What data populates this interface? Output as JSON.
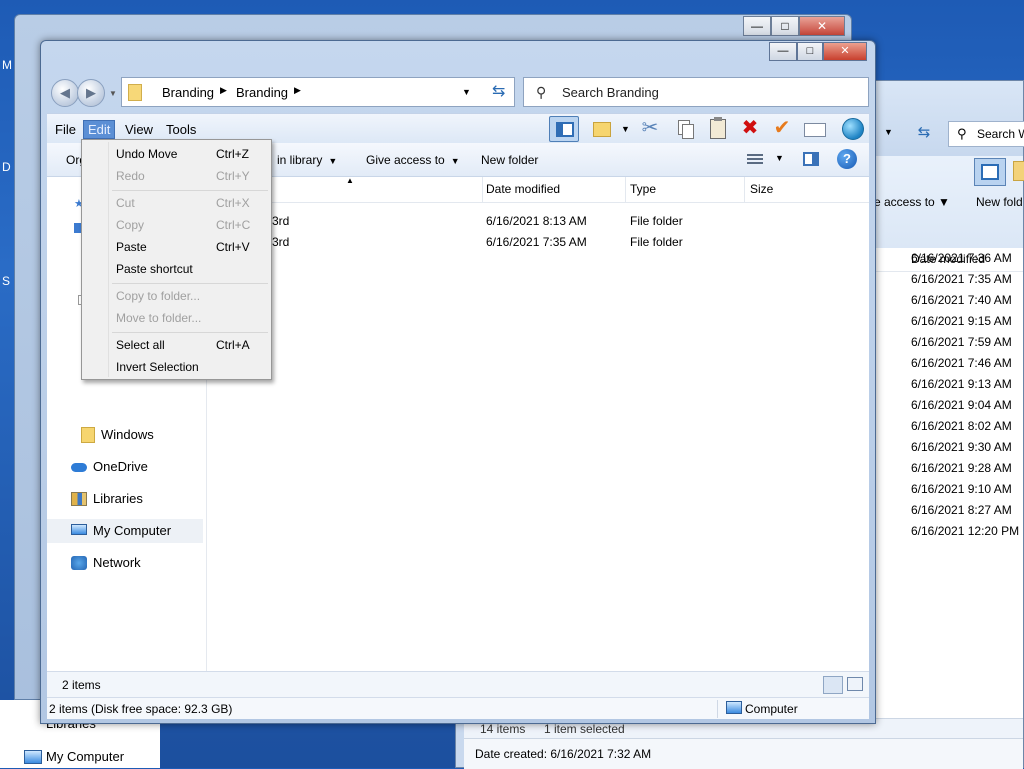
{
  "back_window_left": {
    "controls": [
      "—",
      "□",
      "✕"
    ],
    "desktop_items": [
      "Libraries",
      "My Computer"
    ]
  },
  "back_window_right": {
    "search_placeholder": "Search W",
    "command": {
      "share": "e access to",
      "new_folder": "New fold"
    },
    "column_header": "Date modified",
    "dates": [
      "6/16/2021 7:36 AM",
      "6/16/2021 7:35 AM",
      "6/16/2021 7:40 AM",
      "6/16/2021 9:15 AM",
      "6/16/2021 7:59 AM",
      "6/16/2021 7:46 AM",
      "6/16/2021 9:13 AM",
      "6/16/2021 9:04 AM",
      "6/16/2021 8:02 AM",
      "6/16/2021 9:30 AM",
      "6/16/2021 9:28 AM",
      "6/16/2021 9:10 AM",
      "6/16/2021 8:27 AM",
      "6/16/2021 12:20 PM"
    ],
    "status_items": "14 items",
    "status_selected": "1 item selected",
    "status_created": "Date created: 6/16/2021 7:32 AM"
  },
  "window": {
    "controls": [
      "—",
      "□",
      "✕"
    ],
    "address": {
      "crumbs": [
        "Branding",
        "Branding"
      ]
    },
    "search": {
      "placeholder": "Search Branding"
    },
    "menu": [
      "File",
      "Edit",
      "View",
      "Tools"
    ],
    "commands": {
      "organize": "Org",
      "include": "in library",
      "share": "Give access to",
      "new_folder": "New folder"
    },
    "nav_pane": [
      {
        "label": "Windows",
        "icon": "folder-icon"
      },
      {
        "label": "OneDrive",
        "icon": "onedrive-icon"
      },
      {
        "label": "Libraries",
        "icon": "libraries-icon"
      },
      {
        "label": "My Computer",
        "icon": "computer-icon",
        "selected": true
      },
      {
        "label": "Network",
        "icon": "network-icon"
      }
    ],
    "columns": [
      "Date modified",
      "Type",
      "Size"
    ],
    "files": [
      {
        "name": "3rd",
        "date": "6/16/2021 8:13 AM",
        "type": "File folder"
      },
      {
        "name": "3rd",
        "date": "6/16/2021 7:35 AM",
        "type": "File folder"
      }
    ],
    "status": {
      "count": "2 items",
      "detail": "2 items (Disk free space: 92.3 GB)",
      "location": "Computer"
    }
  },
  "edit_menu": {
    "items": [
      {
        "label": "Undo Move",
        "shortcut": "Ctrl+Z",
        "enabled": true
      },
      {
        "label": "Redo",
        "shortcut": "Ctrl+Y",
        "enabled": false
      },
      {
        "label": "Cut",
        "shortcut": "Ctrl+X",
        "enabled": false
      },
      {
        "label": "Copy",
        "shortcut": "Ctrl+C",
        "enabled": false
      },
      {
        "label": "Paste",
        "shortcut": "Ctrl+V",
        "enabled": true
      },
      {
        "label": "Paste shortcut",
        "shortcut": "",
        "enabled": true
      },
      {
        "label": "Copy to folder...",
        "shortcut": "",
        "enabled": false
      },
      {
        "label": "Move to folder...",
        "shortcut": "",
        "enabled": false
      },
      {
        "label": "Select all",
        "shortcut": "Ctrl+A",
        "enabled": true
      },
      {
        "label": "Invert Selection",
        "shortcut": "",
        "enabled": true
      }
    ]
  },
  "colors": {
    "accent": "#3f6fb4",
    "delete": "#d01010",
    "check": "#e77b1d"
  }
}
